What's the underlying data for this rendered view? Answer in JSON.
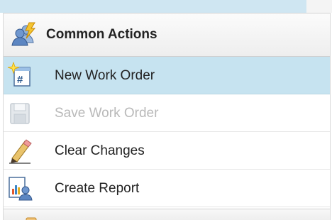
{
  "header": {
    "title": "Common Actions",
    "icon": "people-lightning-icon"
  },
  "actions": [
    {
      "label": "New Work Order",
      "icon": "new-document-icon",
      "state": "selected"
    },
    {
      "label": "Save Work Order",
      "icon": "save-disk-icon",
      "state": "disabled"
    },
    {
      "label": "Clear Changes",
      "icon": "eraser-pencil-icon",
      "state": "normal"
    },
    {
      "label": "Create Report",
      "icon": "report-user-icon",
      "state": "normal"
    }
  ],
  "colors": {
    "selected_row": "#c6e3f0",
    "disabled_text": "#b9b9b9",
    "header_text": "#222222"
  }
}
